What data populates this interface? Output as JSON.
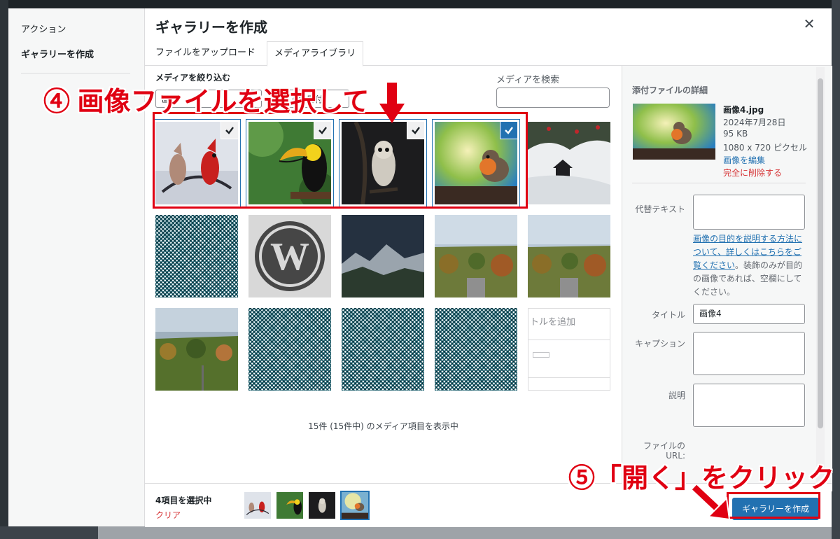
{
  "sidebar": {
    "items": [
      {
        "label": "アクション"
      },
      {
        "label": "ギャラリーを作成"
      }
    ]
  },
  "modal": {
    "title": "ギャラリーを作成",
    "close_icon": "close-icon",
    "tabs": [
      {
        "label": "ファイルをアップロード"
      },
      {
        "label": "メディアライブラリ",
        "active": true
      }
    ]
  },
  "toolbar": {
    "filter_label": "メディアを絞り込む",
    "filter_type_value": "画像",
    "filter_date_value": "すべての日付",
    "search_label": "メディアを検索",
    "search_value": ""
  },
  "grid": {
    "items": [
      {
        "name": "cardinals",
        "checked": true
      },
      {
        "name": "toucan",
        "checked": true
      },
      {
        "name": "owl",
        "checked": true
      },
      {
        "name": "robin",
        "checked": true,
        "focused": true
      },
      {
        "name": "snowy-lantern",
        "checked": false
      },
      {
        "name": "placeholder-pattern",
        "checked": false
      },
      {
        "name": "wordpress-logo",
        "checked": false
      },
      {
        "name": "mountains",
        "checked": false
      },
      {
        "name": "autumn-landscape",
        "checked": false
      },
      {
        "name": "autumn-landscape-2",
        "checked": false
      },
      {
        "name": "autumn-river",
        "checked": false
      },
      {
        "name": "placeholder-pattern",
        "checked": false
      },
      {
        "name": "placeholder-pattern",
        "checked": false
      },
      {
        "name": "placeholder-pattern",
        "checked": false
      },
      {
        "name": "editor-screenshot",
        "checked": false,
        "text": "トルを追加"
      }
    ],
    "count_text": "15件 (15件中) のメディア項目を表示中"
  },
  "details": {
    "heading": "添付ファイルの詳細",
    "filename": "画像4.jpg",
    "date": "2024年7月28日",
    "size": "95 KB",
    "dimensions": "1080 x 720 ピクセル",
    "edit_link": "画像を編集",
    "delete_link": "完全に削除する",
    "alt_label": "代替テキスト",
    "alt_help_link": "画像の目的を説明する方法について、詳しくはこちらをご覧ください",
    "alt_help_rest": "。装飾のみが目的の画像であれば、空欄にしてください。",
    "title_label": "タイトル",
    "title_value": "画像4",
    "caption_label": "キャプション",
    "description_label": "説明",
    "url_label_1": "ファイルの",
    "url_label_2": "URL:"
  },
  "footer": {
    "selected_count": "4項目を選択中",
    "clear_label": "クリア",
    "create_button": "ギャラリーを作成"
  },
  "annotations": {
    "step4": "④ 画像ファイルを選択して",
    "step5": "⑤「開く」をクリック"
  },
  "colors": {
    "accent": "#2271b1",
    "annotation_red": "#e00012",
    "danger": "#d63638"
  }
}
